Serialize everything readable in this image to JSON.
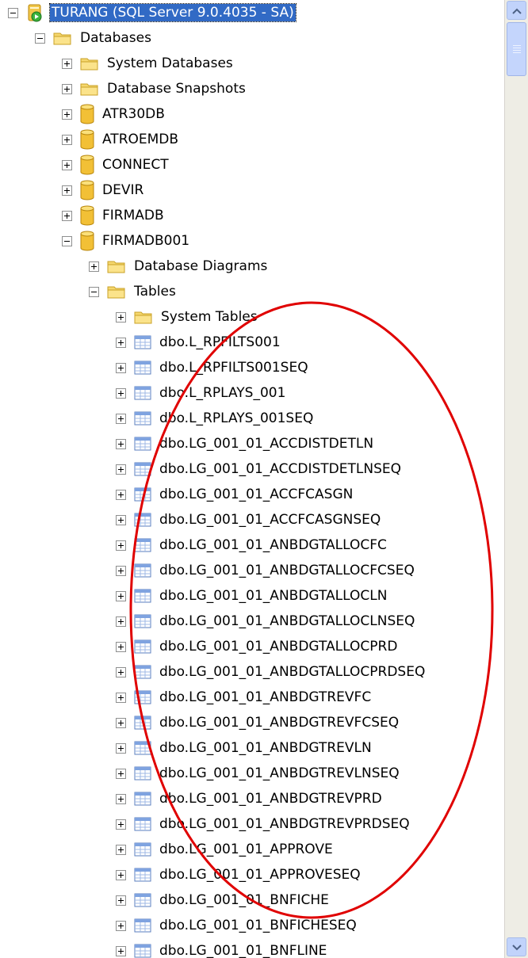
{
  "tree": [
    {
      "depth": 0,
      "icon": "server",
      "expander": "minus",
      "label": "TURANG (SQL Server 9.0.4035 - SA)",
      "selected": true
    },
    {
      "depth": 1,
      "icon": "folder",
      "expander": "minus",
      "label": "Databases"
    },
    {
      "depth": 2,
      "icon": "folder",
      "expander": "plus",
      "label": "System Databases"
    },
    {
      "depth": 2,
      "icon": "folder",
      "expander": "plus",
      "label": "Database Snapshots"
    },
    {
      "depth": 2,
      "icon": "database",
      "expander": "plus",
      "label": "ATR30DB"
    },
    {
      "depth": 2,
      "icon": "database",
      "expander": "plus",
      "label": "ATROEMDB"
    },
    {
      "depth": 2,
      "icon": "database",
      "expander": "plus",
      "label": "CONNECT"
    },
    {
      "depth": 2,
      "icon": "database",
      "expander": "plus",
      "label": "DEVIR"
    },
    {
      "depth": 2,
      "icon": "database",
      "expander": "plus",
      "label": "FIRMADB"
    },
    {
      "depth": 2,
      "icon": "database",
      "expander": "minus",
      "label": "FIRMADB001"
    },
    {
      "depth": 3,
      "icon": "folder",
      "expander": "plus",
      "label": "Database Diagrams"
    },
    {
      "depth": 3,
      "icon": "folder",
      "expander": "minus",
      "label": "Tables"
    },
    {
      "depth": 4,
      "icon": "folder",
      "expander": "plus",
      "label": "System Tables"
    },
    {
      "depth": 4,
      "icon": "table",
      "expander": "plus",
      "label": "dbo.L_RPFILTS001"
    },
    {
      "depth": 4,
      "icon": "table",
      "expander": "plus",
      "label": "dbo.L_RPFILTS001SEQ"
    },
    {
      "depth": 4,
      "icon": "table",
      "expander": "plus",
      "label": "dbo.L_RPLAYS_001"
    },
    {
      "depth": 4,
      "icon": "table",
      "expander": "plus",
      "label": "dbo.L_RPLAYS_001SEQ"
    },
    {
      "depth": 4,
      "icon": "table",
      "expander": "plus",
      "label": "dbo.LG_001_01_ACCDISTDETLN"
    },
    {
      "depth": 4,
      "icon": "table",
      "expander": "plus",
      "label": "dbo.LG_001_01_ACCDISTDETLNSEQ"
    },
    {
      "depth": 4,
      "icon": "table",
      "expander": "plus",
      "label": "dbo.LG_001_01_ACCFCASGN"
    },
    {
      "depth": 4,
      "icon": "table",
      "expander": "plus",
      "label": "dbo.LG_001_01_ACCFCASGNSEQ"
    },
    {
      "depth": 4,
      "icon": "table",
      "expander": "plus",
      "label": "dbo.LG_001_01_ANBDGTALLOCFC"
    },
    {
      "depth": 4,
      "icon": "table",
      "expander": "plus",
      "label": "dbo.LG_001_01_ANBDGTALLOCFCSEQ"
    },
    {
      "depth": 4,
      "icon": "table",
      "expander": "plus",
      "label": "dbo.LG_001_01_ANBDGTALLOCLN"
    },
    {
      "depth": 4,
      "icon": "table",
      "expander": "plus",
      "label": "dbo.LG_001_01_ANBDGTALLOCLNSEQ"
    },
    {
      "depth": 4,
      "icon": "table",
      "expander": "plus",
      "label": "dbo.LG_001_01_ANBDGTALLOCPRD"
    },
    {
      "depth": 4,
      "icon": "table",
      "expander": "plus",
      "label": "dbo.LG_001_01_ANBDGTALLOCPRDSEQ"
    },
    {
      "depth": 4,
      "icon": "table",
      "expander": "plus",
      "label": "dbo.LG_001_01_ANBDGTREVFC"
    },
    {
      "depth": 4,
      "icon": "table",
      "expander": "plus",
      "label": "dbo.LG_001_01_ANBDGTREVFCSEQ"
    },
    {
      "depth": 4,
      "icon": "table",
      "expander": "plus",
      "label": "dbo.LG_001_01_ANBDGTREVLN"
    },
    {
      "depth": 4,
      "icon": "table",
      "expander": "plus",
      "label": "dbo.LG_001_01_ANBDGTREVLNSEQ"
    },
    {
      "depth": 4,
      "icon": "table",
      "expander": "plus",
      "label": "dbo.LG_001_01_ANBDGTREVPRD"
    },
    {
      "depth": 4,
      "icon": "table",
      "expander": "plus",
      "label": "dbo.LG_001_01_ANBDGTREVPRDSEQ"
    },
    {
      "depth": 4,
      "icon": "table",
      "expander": "plus",
      "label": "dbo.LG_001_01_APPROVE"
    },
    {
      "depth": 4,
      "icon": "table",
      "expander": "plus",
      "label": "dbo.LG_001_01_APPROVESEQ"
    },
    {
      "depth": 4,
      "icon": "table",
      "expander": "plus",
      "label": "dbo.LG_001_01_BNFICHE"
    },
    {
      "depth": 4,
      "icon": "table",
      "expander": "plus",
      "label": "dbo.LG_001_01_BNFICHESEQ"
    },
    {
      "depth": 4,
      "icon": "table",
      "expander": "plus",
      "label": "dbo.LG_001_01_BNFLINE"
    }
  ],
  "annotation": {
    "shape": "ellipse",
    "color": "#e00000"
  },
  "scrollbar": {
    "up_icon": "chevron-up-icon",
    "down_icon": "chevron-down-icon"
  }
}
